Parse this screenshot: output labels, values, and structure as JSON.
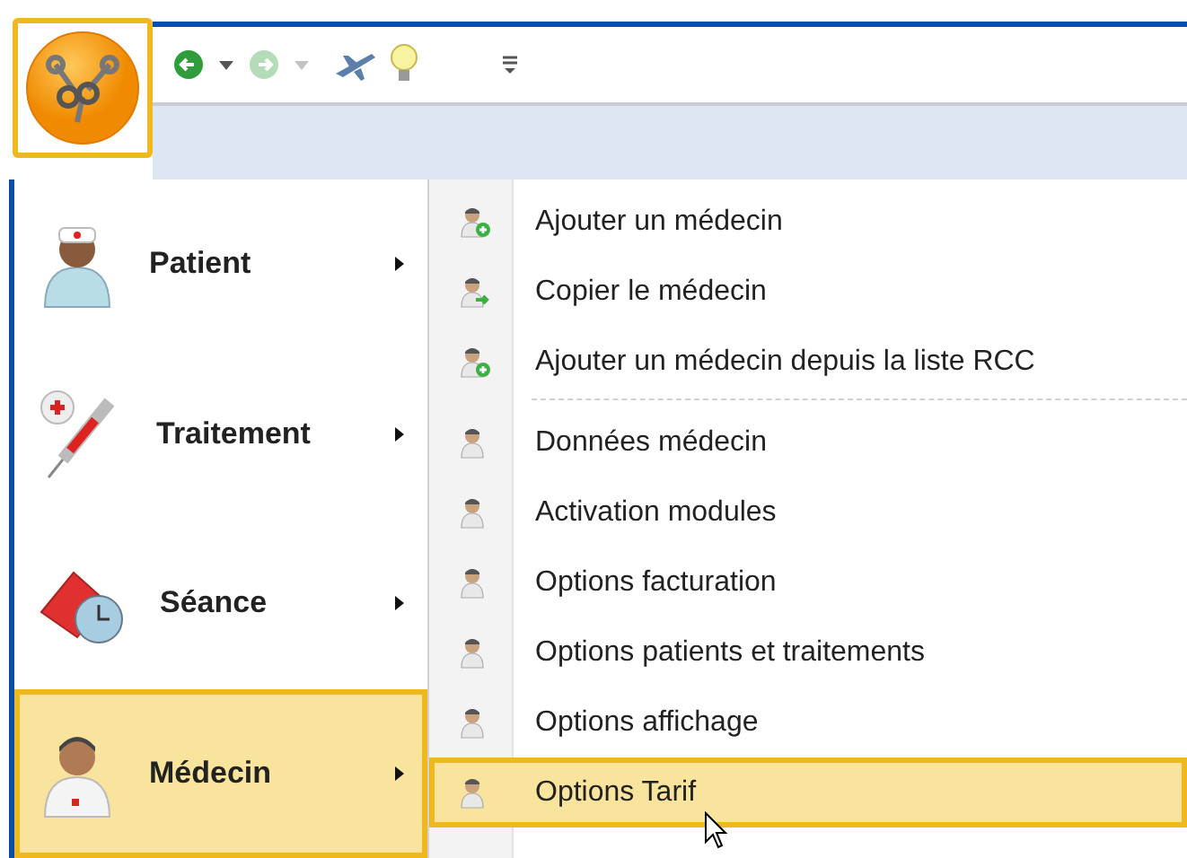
{
  "toolbar": [
    {
      "kind": "back",
      "disabled": false
    },
    {
      "kind": "dropdown",
      "disabled": false
    },
    {
      "kind": "forward",
      "disabled": true
    },
    {
      "kind": "dropdown",
      "disabled": true
    },
    {
      "kind": "plane",
      "disabled": false
    },
    {
      "kind": "bulb",
      "disabled": false
    },
    {
      "kind": "customize",
      "disabled": false
    }
  ],
  "main_menu": [
    {
      "label": "Patient",
      "kind": "patient",
      "selected": false
    },
    {
      "label": "Traitement",
      "kind": "treatment",
      "selected": false
    },
    {
      "label": "Séance",
      "kind": "session",
      "selected": false
    },
    {
      "label": "Médecin",
      "kind": "doctor",
      "selected": true
    }
  ],
  "submenu": [
    {
      "label": "Ajouter un médecin",
      "kind": "add",
      "selected": false
    },
    {
      "label": "Copier le médecin",
      "kind": "copy",
      "selected": false
    },
    {
      "label": "Ajouter un médecin depuis la liste RCC",
      "kind": "add",
      "selected": false
    },
    {
      "kind": "separator"
    },
    {
      "label": "Données médecin",
      "kind": "plain",
      "selected": false
    },
    {
      "label": "Activation modules",
      "kind": "plain",
      "selected": false
    },
    {
      "label": "Options facturation",
      "kind": "plain",
      "selected": false
    },
    {
      "label": "Options patients et traitements",
      "kind": "plain",
      "selected": false
    },
    {
      "label": "Options affichage",
      "kind": "plain",
      "selected": false
    },
    {
      "label": "Options Tarif",
      "kind": "plain",
      "selected": true
    }
  ]
}
